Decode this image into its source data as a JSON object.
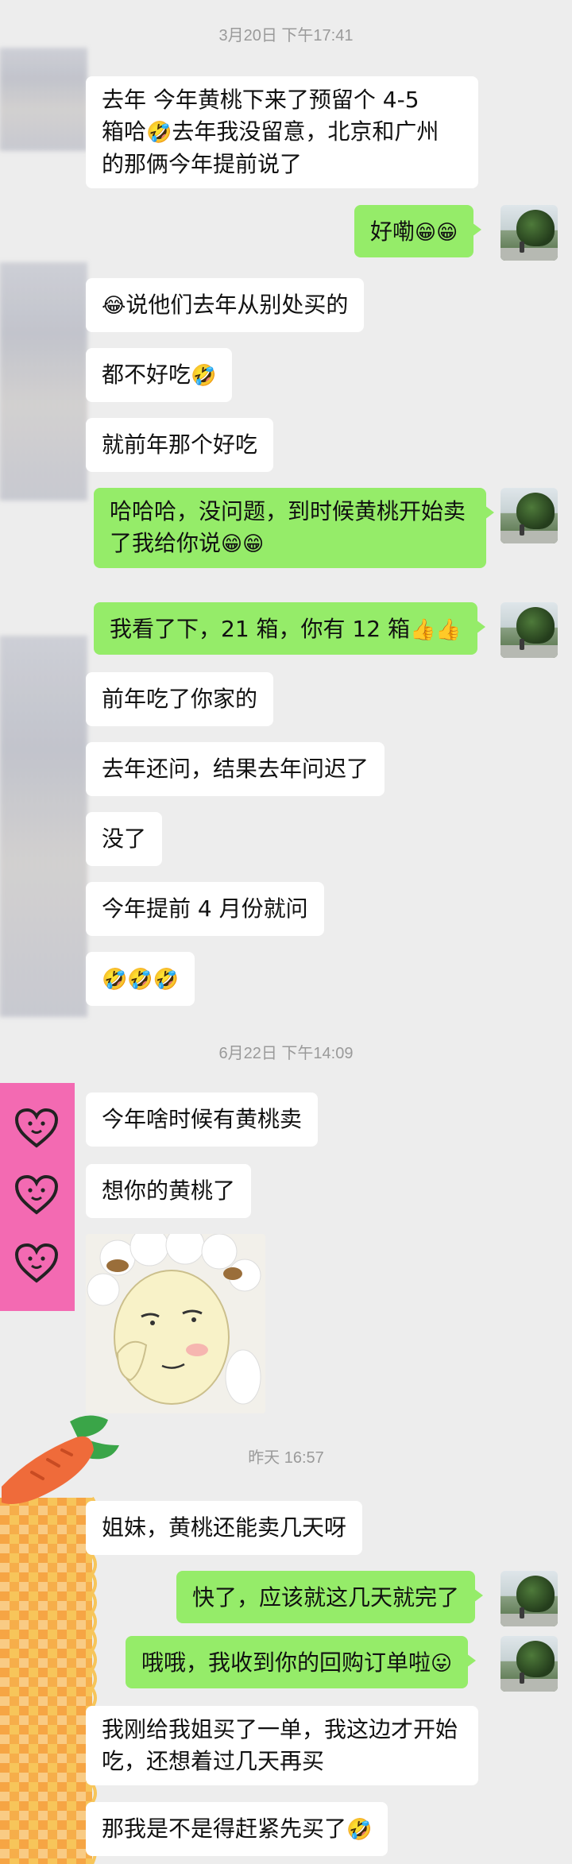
{
  "timestamps": {
    "t1": "3月20日 下午17:41",
    "t2": "6月22日 下午14:09",
    "t3": "昨天 16:57"
  },
  "messages": {
    "m1_line1": "去年 今年黄桃下来了预留个 4-5",
    "m1_line2a": "箱哈",
    "m1_line2b": "去年我没留意，北京和广州",
    "m1_line3": "的那俩今年提前说了",
    "m2_text": "好嘞",
    "m3_text": "说他们去年从别处买的",
    "m4_text": "都不好吃",
    "m5_text": "就前年那个好吃",
    "m6_line1": "哈哈哈，没问题，到时候黄桃开始卖",
    "m6_line2": "了我给你说",
    "m7_text": "我看了下，21 箱，你有 12 箱",
    "m8_text": "前年吃了你家的",
    "m9_text": "去年还问，结果去年问迟了",
    "m10_text": "没了",
    "m11_text": "今年提前 4 月份就问",
    "m13_text": "今年啥时候有黄桃卖",
    "m14_text": "想你的黄桃了",
    "m15_text": "姐妹，黄桃还能卖几天呀",
    "m16_text": "快了，应该就这几天就完了",
    "m17_text": "哦哦，我收到你的回购订单啦",
    "m18_line1": "我刚给我姐买了一单，我这边才开始",
    "m18_line2": "吃，还想着过几天再买",
    "m19_text": "那我是不是得赶紧先买了"
  },
  "emoji": {
    "grin": "😁",
    "laugh_cry": "😂",
    "rofl": "🤣",
    "thumbs_up": "👍",
    "tongue": "😛"
  },
  "colors": {
    "sent_bubble": "#95ec69",
    "received_bubble": "#ffffff",
    "background": "#ededed",
    "pink_panel": "#f36ab2"
  }
}
